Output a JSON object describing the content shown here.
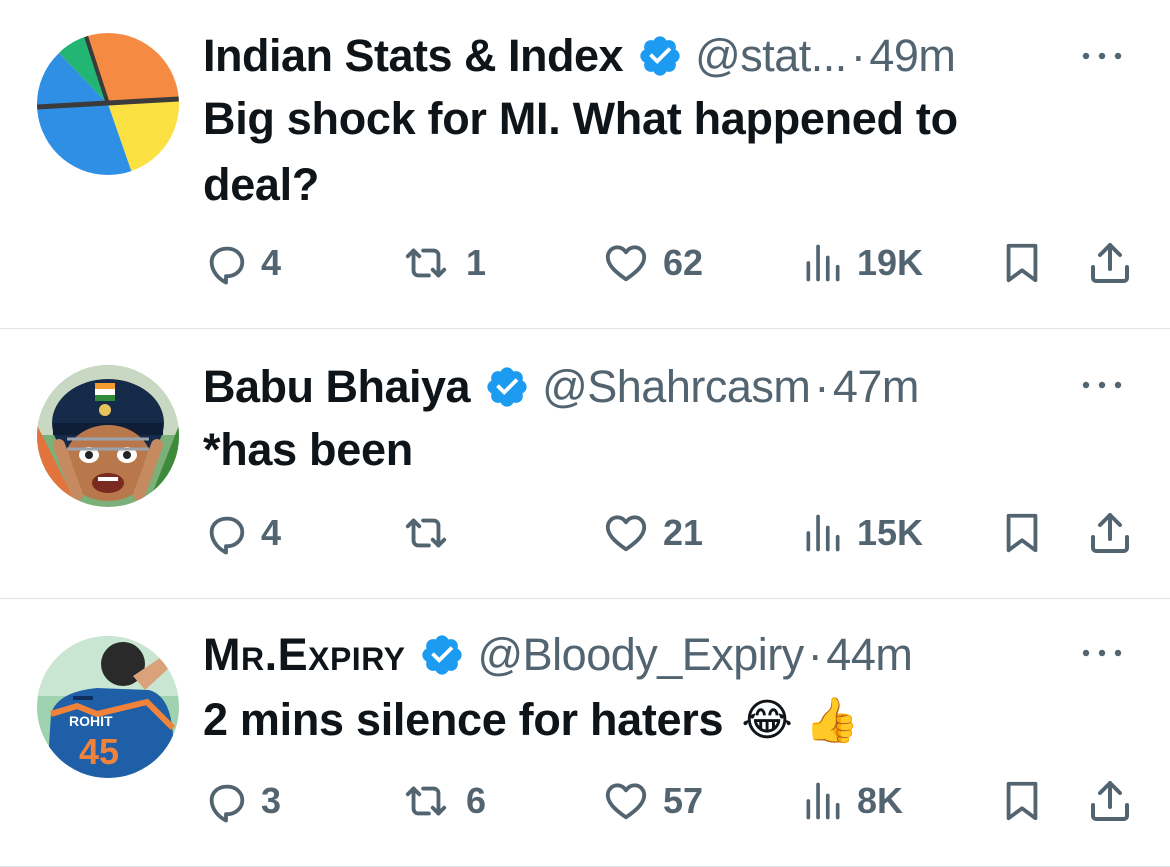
{
  "tweets": [
    {
      "name": "Indian Stats & Index",
      "handle": "@stat...",
      "separator": "·",
      "time": "49m",
      "text": "Big shock for MI. What happened to deal?",
      "emoji": "",
      "avatar": "pie-chart-avatar",
      "stats": {
        "replies": "4",
        "retweets": "1",
        "likes": "62",
        "views": "19K"
      }
    },
    {
      "name": "Babu Bhaiya",
      "handle": "@Shahrcasm",
      "separator": "·",
      "time": "47m",
      "text": "*has been",
      "emoji": "",
      "avatar": "cricket-helmet-face-avatar",
      "stats": {
        "replies": "4",
        "retweets": "",
        "likes": "21",
        "views": "15K"
      }
    },
    {
      "name": "Mr.Expiry",
      "handle": "@Bloody_Expiry",
      "separator": "·",
      "time": "44m",
      "text": "2 mins silence for haters",
      "emoji": "😂 👍",
      "avatar": "cricket-jersey-avatar",
      "jersey_name": "ROHIT",
      "jersey_number": "45",
      "stats": {
        "replies": "3",
        "retweets": "6",
        "likes": "57",
        "views": "8K"
      }
    }
  ],
  "colors": {
    "text": "#0f1419",
    "secondary": "#536471",
    "verified": "#1d9bf0",
    "divider": "#dfe3e6"
  },
  "icons": [
    "reply-icon",
    "retweet-icon",
    "like-icon",
    "views-icon",
    "bookmark-icon",
    "share-icon",
    "verified-badge-icon",
    "more-icon"
  ]
}
